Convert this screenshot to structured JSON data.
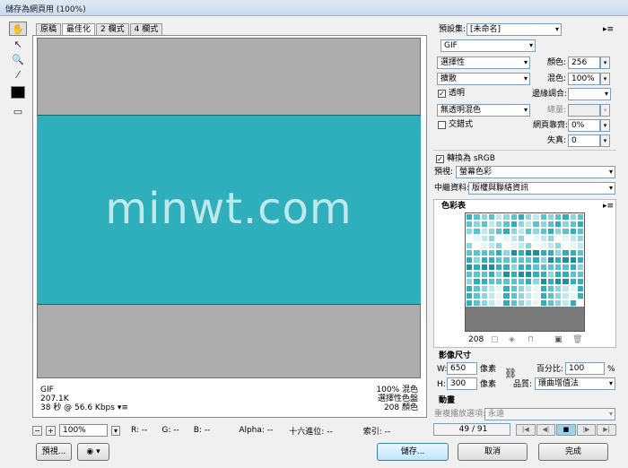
{
  "window": {
    "title": "儲存為網頁用 (100%)"
  },
  "tabs": [
    "原稿",
    "最佳化",
    "2 欄式",
    "4 欄式"
  ],
  "preview_text": "minwt.com",
  "info_left": [
    "GIF",
    "207.1K",
    "38 秒 @ 56.6 Kbps"
  ],
  "info_left_menu": "▾≡",
  "info_right": [
    "100% 混色",
    "選擇性色盤",
    "208 顏色"
  ],
  "status": {
    "minus": "−",
    "plus": "+",
    "zoom": "100%",
    "r": "R: --",
    "g": "G: --",
    "b": "B: --",
    "alpha": "Alpha: --",
    "hex": "十六進位: --",
    "index": "索引: --"
  },
  "bottom_buttons": {
    "preview": "預視...",
    "save": "儲存...",
    "cancel": "取消",
    "done": "完成"
  },
  "settings": {
    "preset_label": "預設集:",
    "preset_value": "[未命名]",
    "format": "GIF",
    "reduction": "選擇性",
    "colors_label": "顏色:",
    "colors_value": "256",
    "dither_algo": "擴散",
    "dither_label": "混色:",
    "dither_value": "100%",
    "transparency_label": "透明",
    "matte_label": "邊緣調合:",
    "trans_dither": "無透明混色",
    "amount_label": "總量:",
    "interlaced_label": "交錯式",
    "websnap_label": "網頁靠齊:",
    "websnap_value": "0%",
    "lossy_label": "失真:",
    "lossy_value": "0",
    "srgb_label": "轉換為 sRGB",
    "preview_label": "預視:",
    "preview_value": "螢幕色彩",
    "metadata_label": "中繼資料:",
    "metadata_value": "版權與聯絡資訊"
  },
  "color_table": {
    "title": "色彩表",
    "count": "208",
    "colors": [
      "#1f8f99",
      "#2eafbb",
      "#5cc3cc",
      "#8fd6dc",
      "#bfe8ec",
      "#e6f6f7",
      "#ffffff",
      "#7a7a7a",
      "#adadad"
    ]
  },
  "image_size": {
    "title": "影像尺寸",
    "w_label": "W:",
    "w_value": "650",
    "h_label": "H:",
    "h_value": "300",
    "unit": "像素",
    "percent_label": "百分比:",
    "percent_value": "100",
    "percent_unit": "%",
    "quality_label": "品質:",
    "quality_value": "環曲增值法"
  },
  "animation": {
    "title": "動畫",
    "loop_label": "重複播放選項:",
    "loop_value": "永遠",
    "frame": "49 / 91"
  }
}
